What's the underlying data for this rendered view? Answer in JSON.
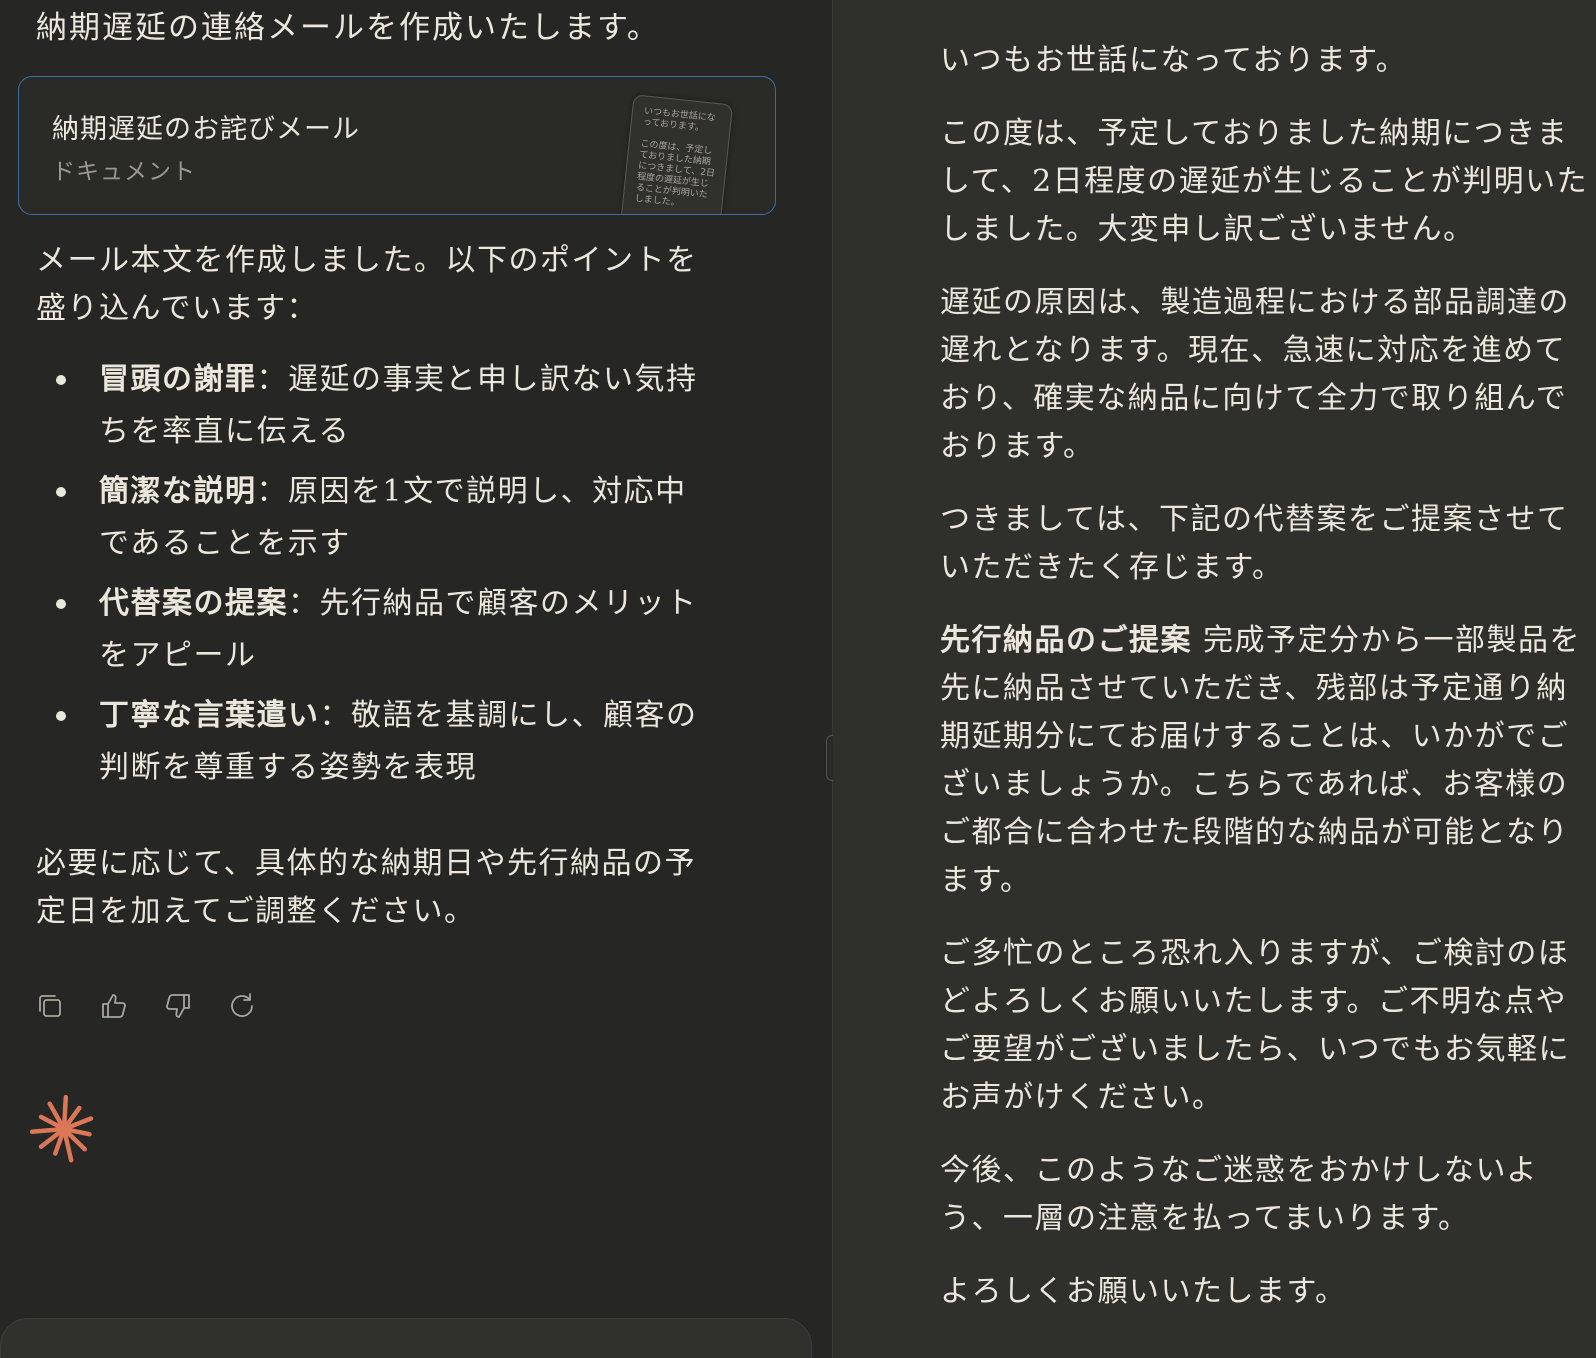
{
  "chat": {
    "intro": "納期遅延の連絡メールを作成いたします。",
    "artifact": {
      "title": "納期遅延のお詫びメール",
      "type": "ドキュメント",
      "thumbnail_text": "いつもお世話になっております。\n\nこの度は、予定しておりました納期につきまして、2日程度の遅延が生じることが判明いたしました。"
    },
    "summary": "メール本文を作成しました。以下のポイントを盛り込んでいます：",
    "points": [
      {
        "title": "冒頭の謝罪",
        "text": "：遅延の事実と申し訳ない気持ちを率直に伝える"
      },
      {
        "title": "簡潔な説明",
        "text": "：原因を1文で説明し、対応中であることを示す"
      },
      {
        "title": "代替案の提案",
        "text": "：先行納品で顧客のメリットをアピール"
      },
      {
        "title": "丁寧な言葉遣い",
        "text": "：敬語を基調にし、顧客の判断を尊重する姿勢を表現"
      }
    ],
    "closing": "必要に応じて、具体的な納期日や先行納品の予定日を加えてご調整ください。",
    "actions": {
      "copy_icon": "copy-icon",
      "thumbs_up_icon": "thumbs-up-icon",
      "thumbs_down_icon": "thumbs-down-icon",
      "retry_icon": "retry-icon"
    },
    "logo_icon": "spark-icon",
    "logo_color": "#d97757"
  },
  "document": {
    "paragraphs": [
      "いつもお世話になっております。",
      "この度は、予定しておりました納期につきまして、2日程度の遅延が生じることが判明いたしました。大変申し訳ございません。",
      "遅延の原因は、製造過程における部品調達の遅れとなります。現在、急速に対応を進めており、確実な納品に向けて全力で取り組んでおります。",
      "つきましては、下記の代替案をご提案させていただきたく存じます。"
    ],
    "proposal": {
      "title": "先行納品のご提案",
      "text": " 完成予定分から一部製品を先に納品させていただき、残部は予定通り納期延期分にてお届けすることは、いかがでございましょうか。こちらであれば、お客様のご都合に合わせた段階的な納品が可能となります。"
    },
    "paragraphs_after": [
      "ご多忙のところ恐れ入りますが、ご検討のほどよろしくお願いいたします。ご不明な点やご要望がございましたら、いつでもお気軽にお声がけください。",
      "今後、このようなご迷惑をおかけしないよう、一層の注意を払ってまいります。",
      "よろしくお願いいたします。"
    ]
  }
}
